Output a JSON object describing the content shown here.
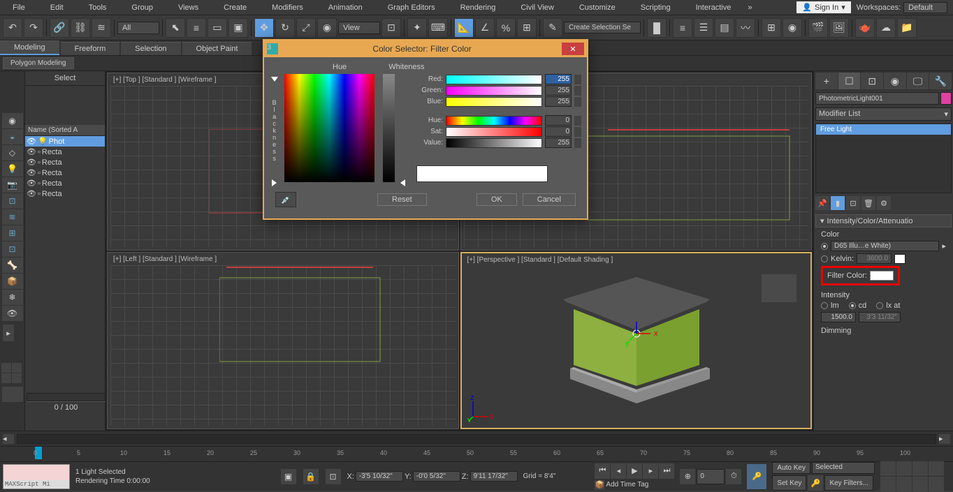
{
  "menu": {
    "file": "File",
    "edit": "Edit",
    "tools": "Tools",
    "group": "Group",
    "views": "Views",
    "create": "Create",
    "modifiers": "Modifiers",
    "animation": "Animation",
    "graph_editors": "Graph Editors",
    "rendering": "Rendering",
    "civil_view": "Civil View",
    "customize": "Customize",
    "scripting": "Scripting",
    "interactive": "Interactive"
  },
  "header": {
    "sign_in": "Sign In",
    "workspaces_label": "Workspaces:",
    "workspace_value": "Default"
  },
  "toolbar": {
    "all": "All",
    "view": "View",
    "create_selection": "Create Selection Se"
  },
  "ribbon": {
    "tabs": {
      "modeling": "Modeling",
      "freeform": "Freeform",
      "selection": "Selection",
      "object_paint": "Object Paint"
    },
    "panel": "Polygon Modeling"
  },
  "scene": {
    "select": "Select",
    "header": "Name (Sorted A",
    "items": [
      "Phot",
      "Recta",
      "Recta",
      "Recta",
      "Recta",
      "Recta"
    ],
    "count": "0 / 100"
  },
  "viewports": {
    "top": "[+] [Top ] [Standard ] [Wireframe ]",
    "front": "",
    "left": "[+] [Left ] [Standard ] [Wireframe ]",
    "persp": "[+] [Perspective ] [Standard ] [Default Shading ]"
  },
  "right_panel": {
    "object_name": "PhotometricLight001",
    "modifier_list": "Modifier List",
    "stack_item": "Free Light",
    "rollout_title": "Intensity/Color/Attenuatio",
    "color_label": "Color",
    "color_preset": "D65 Illu…e White)",
    "kelvin_label": "Kelvin:",
    "kelvin_value": "3600.0",
    "filter_label": "Filter Color:",
    "intensity_label": "Intensity",
    "lm": "lm",
    "cd": "cd",
    "lxat": "lx at",
    "intensity_value": "1500.0",
    "distance_value": "3'3 11/32\"",
    "dimming": "Dimming"
  },
  "dialog": {
    "title": "Color Selector: Filter Color",
    "hue_label": "Hue",
    "whiteness_label": "Whiteness",
    "blackness_label": "Blackness",
    "red": "Red:",
    "green": "Green:",
    "blue": "Blue:",
    "hue": "Hue:",
    "sat": "Sat:",
    "value": "Value:",
    "red_val": "255",
    "green_val": "255",
    "blue_val": "255",
    "hue_val": "0",
    "sat_val": "0",
    "value_val": "255",
    "reset": "Reset",
    "ok": "OK",
    "cancel": "Cancel"
  },
  "status": {
    "maxscript": "MAXScript Mi",
    "selected": "1 Light Selected",
    "render_time": "Rendering Time  0:00:00",
    "x_label": "X:",
    "x_val": "-3'5 10/32\"",
    "y_label": "Y:",
    "y_val": "-0'0 5/32\"",
    "z_label": "Z:",
    "z_val": "9'11 17/32\"",
    "grid": "Grid = 8'4\"",
    "add_time_tag": "Add Time Tag",
    "frame": "0",
    "auto_key": "Auto Key",
    "set_key": "Set Key",
    "selected_filter": "Selected",
    "key_filters": "Key Filters..."
  },
  "ruler": [
    "0",
    "5",
    "10",
    "15",
    "20",
    "25",
    "30",
    "35",
    "40",
    "45",
    "50",
    "55",
    "60",
    "65",
    "70",
    "75",
    "80",
    "85",
    "90",
    "95",
    "100"
  ]
}
